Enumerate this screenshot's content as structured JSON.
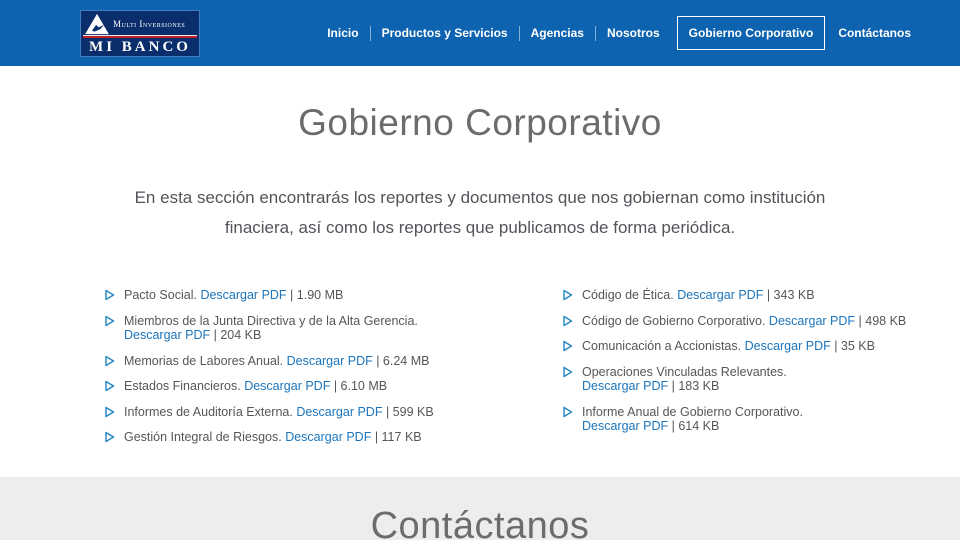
{
  "brand": {
    "top_text": "Multi Inversiones",
    "bottom_text": "MI BANCO"
  },
  "nav": {
    "items": [
      {
        "label": "Inicio",
        "active": false
      },
      {
        "label": "Productos y Servicios",
        "active": false
      },
      {
        "label": "Agencias",
        "active": false
      },
      {
        "label": "Nosotros",
        "active": false
      },
      {
        "label": "Gobierno Corporativo",
        "active": true
      },
      {
        "label": "Contáctanos",
        "active": false
      }
    ]
  },
  "page": {
    "title": "Gobierno Corporativo",
    "intro_line1": "En esta sección encontrarás los reportes y documentos que nos gobiernan como institución",
    "intro_line2": "finaciera, así como los reportes que publicamos de forma periódica."
  },
  "documents": {
    "link_label": "Descargar PDF",
    "separator": "|",
    "left": [
      {
        "name": "Pacto Social.",
        "size": "1.90 MB",
        "wrap": false
      },
      {
        "name": "Miembros de la Junta Directiva y de la Alta Gerencia.",
        "size": "204 KB",
        "wrap": true
      },
      {
        "name": "Memorias de Labores Anual.",
        "size": "6.24 MB",
        "wrap": false
      },
      {
        "name": "Estados Financieros.",
        "size": "6.10 MB",
        "wrap": false
      },
      {
        "name": "Informes de Auditoría Externa.",
        "size": "599 KB",
        "wrap": false
      },
      {
        "name": "Gestión Integral de Riesgos.",
        "size": "117 KB",
        "wrap": false
      }
    ],
    "right": [
      {
        "name": "Código de Ética.",
        "size": "343 KB",
        "wrap": false
      },
      {
        "name": "Código de Gobierno Corporativo.",
        "size": "498 KB",
        "wrap": false
      },
      {
        "name": "Comunicación a Accionistas.",
        "size": "35 KB",
        "wrap": false
      },
      {
        "name": "Operaciones Vinculadas Relevantes.",
        "size": "183 KB",
        "wrap": true
      },
      {
        "name": "Informe Anual de Gobierno Corporativo.",
        "size": "614 KB",
        "wrap": true
      }
    ]
  },
  "footer": {
    "title": "Contáctanos"
  },
  "colors": {
    "header_blue": "#0d63af",
    "logo_navy": "#0a2e6b",
    "logo_red": "#c02026",
    "link_blue": "#1c75bc",
    "bullet_blue": "#2286c3",
    "text_gray": "#55565a",
    "title_gray": "#6b6c6e",
    "footer_background": "#ededed"
  }
}
